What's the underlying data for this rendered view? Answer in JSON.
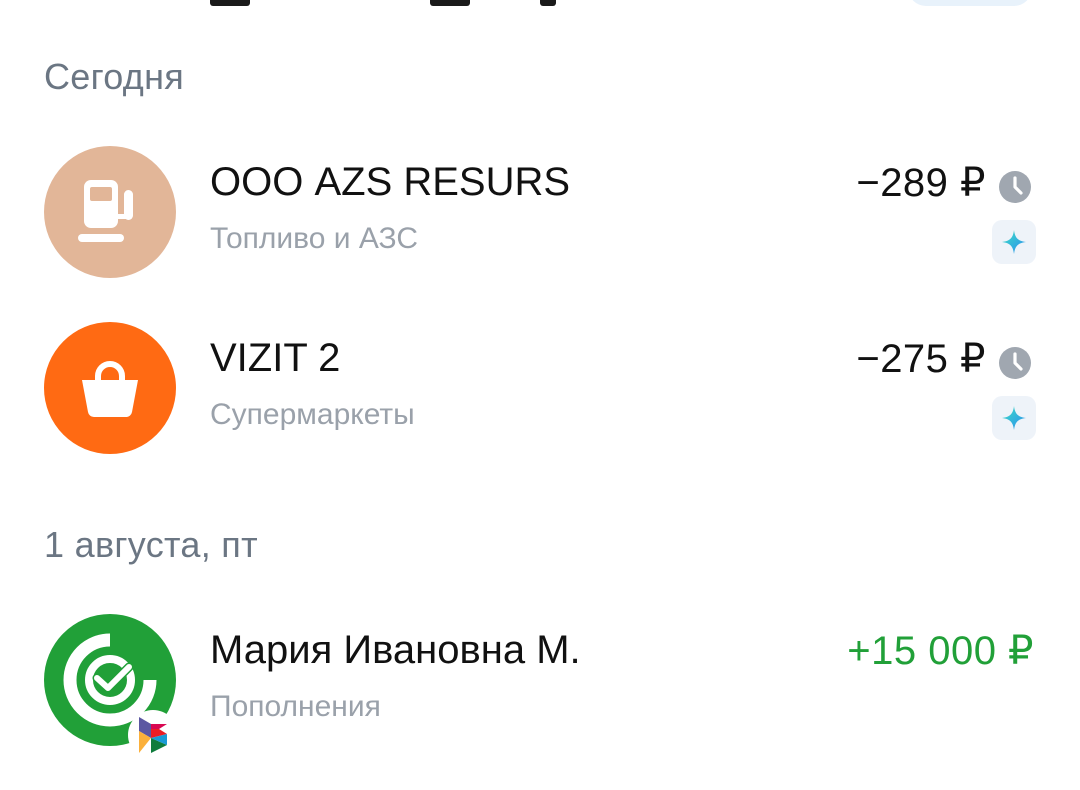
{
  "sections": [
    {
      "date_label": "Сегодня",
      "transactions": [
        {
          "name": "ООО AZS RESURS",
          "category": "Топливо и АЗС",
          "amount": "−289 ₽",
          "icon": "fuel-pump-icon",
          "icon_bg": "#e2b698",
          "status_icon": "clock-icon",
          "badge_icon": "sparkle-icon"
        },
        {
          "name": "VIZIT 2",
          "category": "Супермаркеты",
          "amount": "−275 ₽",
          "icon": "shopping-bag-icon",
          "icon_bg": "#ff6a13",
          "status_icon": "clock-icon",
          "badge_icon": "sparkle-icon"
        }
      ]
    },
    {
      "date_label": "1 августа, пт",
      "transactions": [
        {
          "name": "Мария Ивановна М.",
          "category": "Пополнения",
          "amount": "+15 000 ₽",
          "icon": "sber-logo-icon",
          "icon_bg": "#21a038",
          "badge_icon": "sbp-logo-icon"
        }
      ]
    }
  ],
  "colors": {
    "income": "#21a038",
    "secondary_text": "#9aa1aa",
    "date_text": "#6b7683",
    "status_icon": "#a0a7b0"
  }
}
